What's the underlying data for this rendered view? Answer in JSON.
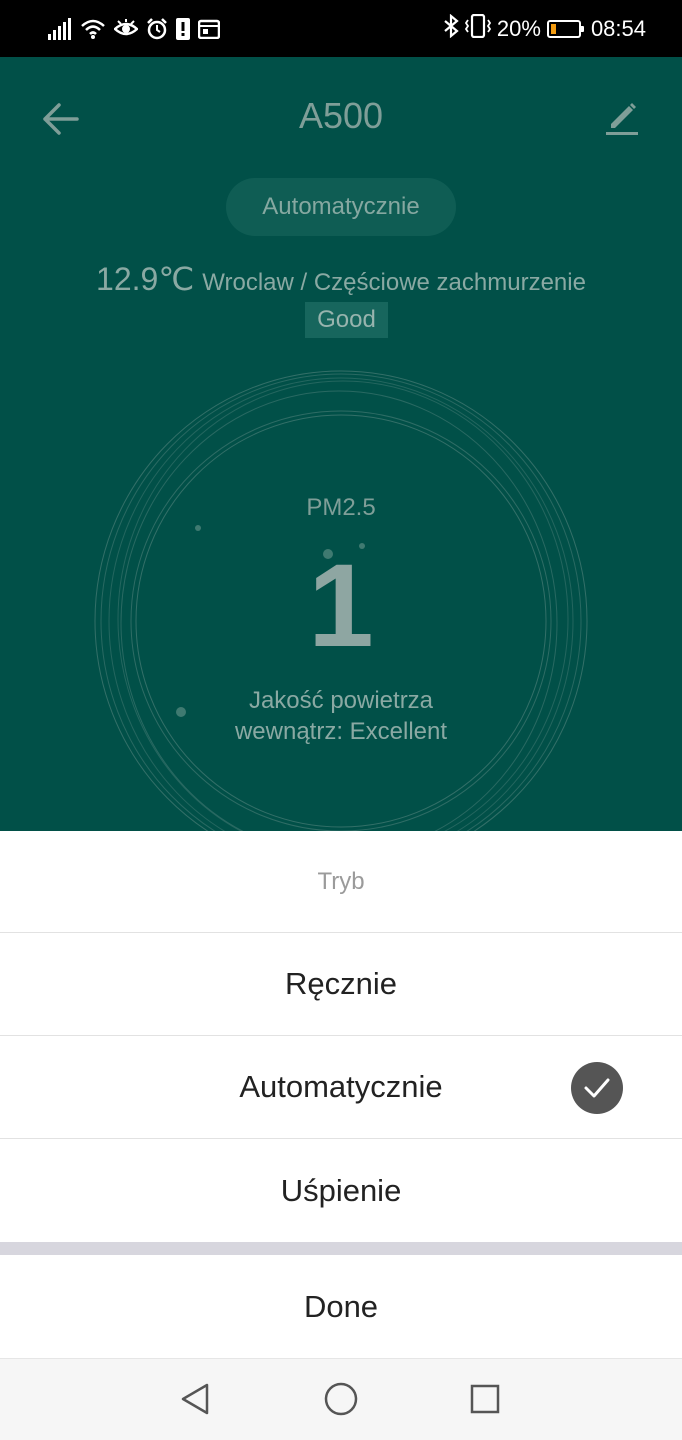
{
  "status_bar": {
    "battery_percent": "20%",
    "battery_level": 0.2,
    "time": "08:54",
    "left_icons": [
      "signal-icon",
      "wifi-icon",
      "eye-icon",
      "alarm-icon",
      "alert-icon",
      "calendar-icon"
    ],
    "right_icons": [
      "bluetooth-icon",
      "vibrate-icon"
    ],
    "battery_color": "#f39c12"
  },
  "device": {
    "title": "A500",
    "mode_pill": "Automatycznie",
    "temperature": "12.9℃",
    "weather": "Wroclaw / Częściowe zachmurzenie",
    "outdoor_quality": "Good",
    "pm_label": "PM2.5",
    "pm_value": "1",
    "aq_line1": "Jakość powietrza",
    "aq_line2": "wewnątrz: Excellent",
    "background_color": "#015048"
  },
  "sheet": {
    "title": "Tryb",
    "options": [
      {
        "label": "Ręcznie",
        "selected": false
      },
      {
        "label": "Automatycznie",
        "selected": true
      },
      {
        "label": "Uśpienie",
        "selected": false
      }
    ],
    "done_label": "Done"
  },
  "nav_bar": {
    "icons": [
      "back-triangle-icon",
      "home-circle-icon",
      "recents-square-icon"
    ]
  }
}
